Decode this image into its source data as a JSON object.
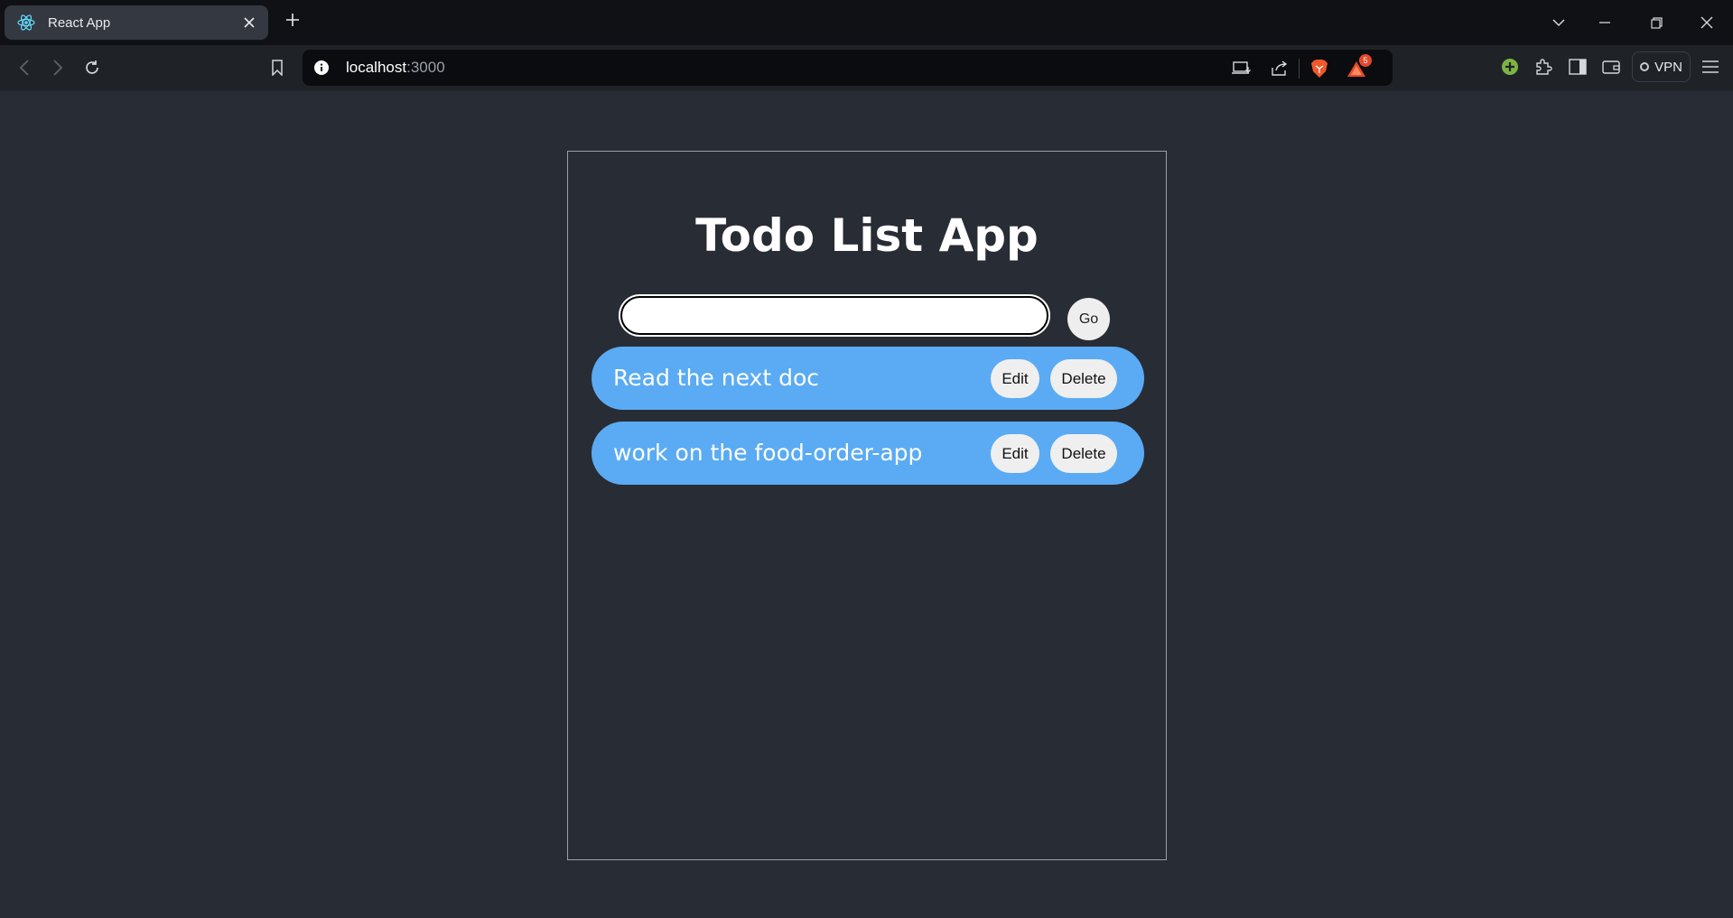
{
  "browser": {
    "tab_title": "React App",
    "url_host": "localhost",
    "url_port": ":3000",
    "notification_badge": "5",
    "vpn_label": "VPN"
  },
  "app": {
    "title": "Todo List App",
    "input_value": "",
    "go_label": "Go",
    "todos": [
      {
        "text": "Read the next doc",
        "edit_label": "Edit",
        "delete_label": "Delete"
      },
      {
        "text": "work on the food-order-app",
        "edit_label": "Edit",
        "delete_label": "Delete"
      }
    ]
  },
  "colors": {
    "page_bg": "#282c34",
    "todo_bg": "#5aabf3",
    "button_bg": "#efefef"
  }
}
